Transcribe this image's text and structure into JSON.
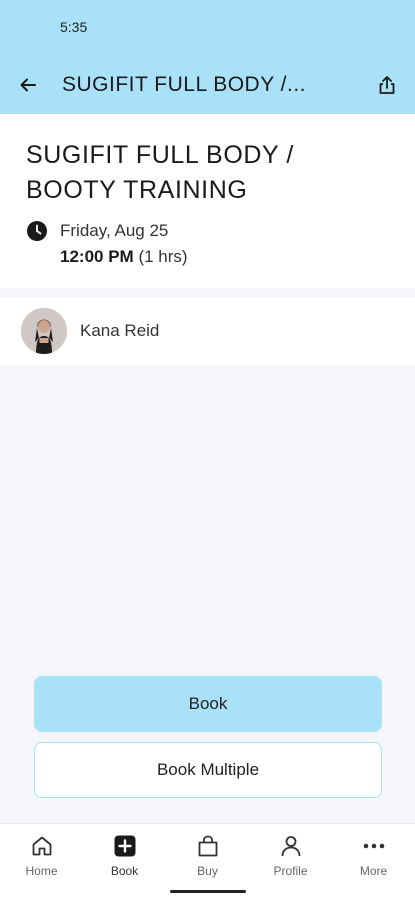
{
  "status_bar": {
    "time": "5:35"
  },
  "app_bar": {
    "title": "SUGIFIT FULL BODY /...",
    "back_icon": "arrow-left-icon",
    "share_icon": "share-icon"
  },
  "class_info": {
    "title": "SUGIFIT FULL BODY / BOOTY TRAINING",
    "date": "Friday, Aug 25",
    "time": "12:00 PM",
    "duration": "(1 hrs)",
    "clock_icon": "clock-icon"
  },
  "instructor": {
    "name": "Kana Reid"
  },
  "actions": {
    "book_label": "Book",
    "book_multiple_label": "Book Multiple"
  },
  "bottom_nav": {
    "items": [
      {
        "label": "Home",
        "icon": "home-icon"
      },
      {
        "label": "Book",
        "icon": "plus-square-icon"
      },
      {
        "label": "Buy",
        "icon": "shopping-bag-icon"
      },
      {
        "label": "Profile",
        "icon": "person-icon"
      },
      {
        "label": "More",
        "icon": "more-dots-icon"
      }
    ]
  },
  "colors": {
    "accent": "#a9e1f9",
    "background": "#f4f6f9",
    "surface": "#ffffff",
    "text": "#1a1a1a"
  }
}
